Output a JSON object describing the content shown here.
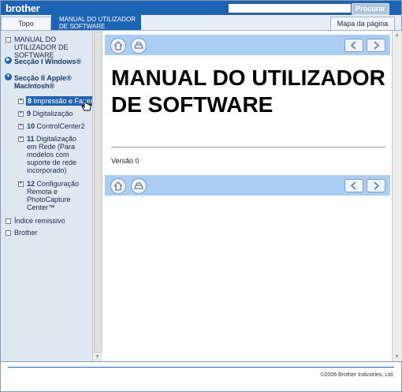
{
  "header": {
    "logo_text": "brother",
    "search_placeholder": "",
    "search_button": "Procurar"
  },
  "tabs": {
    "topo": "Topo",
    "manual_line1": "MANUAL DO UTILIZADOR",
    "manual_line2": "DE SOFTWARE",
    "mapa": "Mapa da página"
  },
  "sidebar": {
    "items": [
      {
        "label": "MANUAL DO UTILIZADOR DE SOFTWARE"
      },
      {
        "label": "Secção I Windows®"
      },
      {
        "label": "Secção II Apple® Macintosh®"
      },
      {
        "num": "8",
        "label": "Impressão e Faxes"
      },
      {
        "num": "9",
        "label": "Digitalização"
      },
      {
        "num": "10",
        "label": "ControlCenter2"
      },
      {
        "num": "11",
        "label": "Digitalização em Rede (Para modelos com suporte de rede incorporado)"
      },
      {
        "num": "12",
        "label": "Configuração Remota e PhotoCapture Center™"
      },
      {
        "label": "Índice remissivo"
      },
      {
        "label": "Brother"
      }
    ]
  },
  "content": {
    "title": "MANUAL DO UTILIZADOR DE SOFTWARE",
    "version": "Versão 0"
  },
  "footer": {
    "copyright": "©2006 Brother Industries, Ltd."
  },
  "colors": {
    "brand_blue": "#1e64b4",
    "nav_band": "#a9cdf3",
    "sidebar_bg": "#dfe7f1"
  }
}
